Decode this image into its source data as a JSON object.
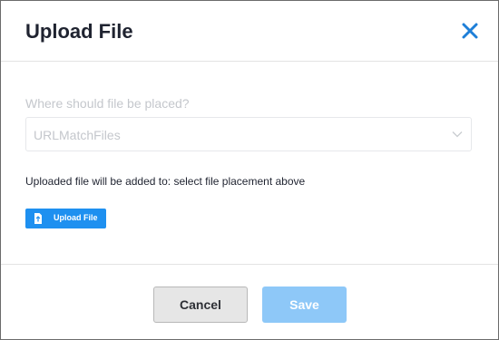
{
  "dialog": {
    "title": "Upload File",
    "close_icon": "close-icon",
    "accent_color": "#1e90f0"
  },
  "placement": {
    "label": "Where should file be placed?",
    "selected": "URLMatchFiles",
    "chevron_icon": "chevron-down-icon"
  },
  "info": {
    "text": "Uploaded file will be added to: select file placement above"
  },
  "upload": {
    "label": "Upload File",
    "icon": "file-upload-icon"
  },
  "footer": {
    "cancel_label": "Cancel",
    "save_label": "Save"
  }
}
